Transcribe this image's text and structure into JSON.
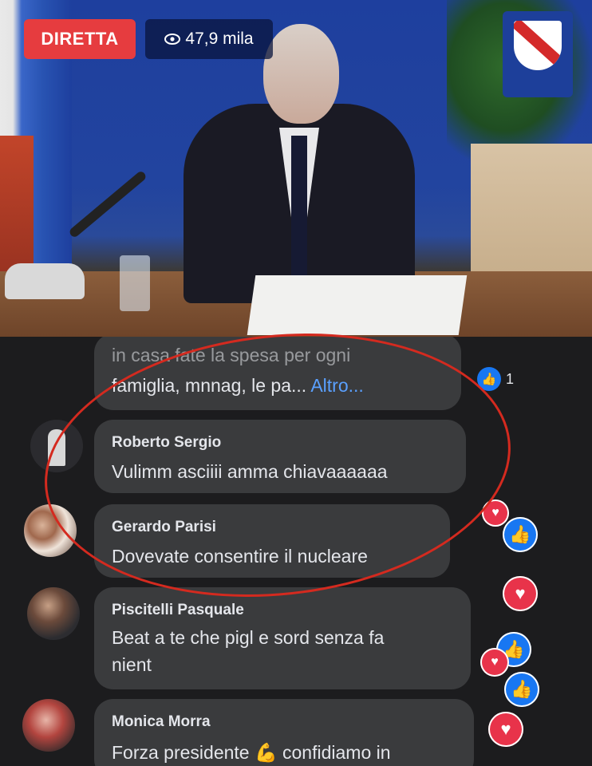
{
  "stream": {
    "live_label": "DIRETTA",
    "viewers": "47,9 mila"
  },
  "comments": [
    {
      "name": "",
      "text_line1": "in casa fate la spesa per ogni",
      "text_line2": "famiglia, mnnag, le pa...",
      "more": "Altro...",
      "likes": "1"
    },
    {
      "name": "Roberto Sergio",
      "text": "Vulimm asciiii amma chiavaaaaaa"
    },
    {
      "name": "Gerardo Parisi",
      "text": "Dovevate consentire il nucleare"
    },
    {
      "name": "Piscitelli Pasquale",
      "text_line1": "Beat a te che pigl e sord senza fa",
      "text_line2": "nient"
    },
    {
      "name": "Monica Morra",
      "text_line1": "Forza presidente",
      "text_line1b": "confidiamo in"
    }
  ],
  "icons": {
    "eye": "eye-icon",
    "like": "thumbs-up-icon",
    "heart": "heart-icon",
    "flex": "flexed-biceps-icon"
  },
  "colors": {
    "live_red": "#e63c3f",
    "bubble": "#3a3b3d",
    "link_blue": "#5aa0ff",
    "annotation_red": "#d42a1f"
  }
}
